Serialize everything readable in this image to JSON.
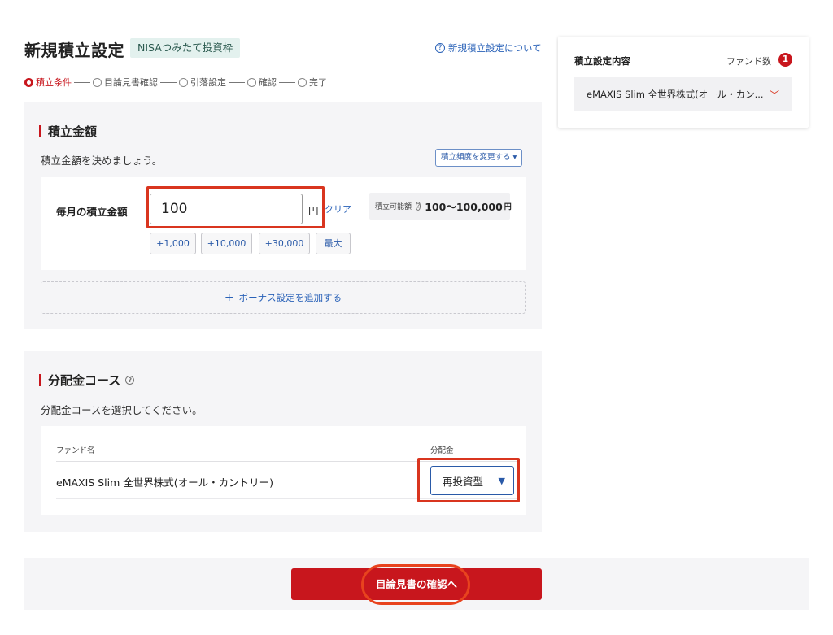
{
  "header": {
    "title": "新規積立設定",
    "badge": "NISAつみたて投資枠",
    "help_link": "新規積立設定について",
    "help_icon": "?"
  },
  "steps": [
    {
      "label": "積立条件",
      "active": true
    },
    {
      "label": "目論見書確認",
      "active": false
    },
    {
      "label": "引落設定",
      "active": false
    },
    {
      "label": "確認",
      "active": false
    },
    {
      "label": "完了",
      "active": false
    }
  ],
  "amount_section": {
    "title": "積立金額",
    "description": "積立金額を決めましょう。",
    "frequency_button": "積立頻度を変更する",
    "frequency_icon": "▾",
    "field_label": "毎月の積立金額",
    "input_value": "100",
    "unit": "円",
    "clear": "クリア",
    "range_label": "積立可能額",
    "range_help": "?",
    "range_value": "100〜100,000",
    "range_unit": "円",
    "quick_buttons": [
      "+1,000",
      "+10,000",
      "+30,000",
      "最大"
    ],
    "bonus_plus": "+",
    "bonus_label": "ボーナス設定を追加する"
  },
  "distribution_section": {
    "title": "分配金コース",
    "help_icon": "?",
    "description": "分配金コースを選択してください。",
    "col_fund": "ファンド名",
    "col_distribution": "分配金",
    "fund_name": "eMAXIS Slim 全世界株式(オール・カントリー)",
    "selected_course": "再投資型",
    "select_arrow": "▼"
  },
  "footer": {
    "confirm_button": "目論見書の確認へ"
  },
  "sidebar": {
    "title": "積立設定内容",
    "fund_count_label": "ファンド数",
    "fund_count": "1",
    "fund": "eMAXIS Slim 全世界株式(オール・カン...",
    "chevron": "﹀"
  },
  "colors": {
    "accent_red": "#c8161d",
    "link_blue": "#2a62b8",
    "badge_green": "#e3f1ee",
    "highlight_box": "#d9351f"
  },
  "icons": {
    "help": "help-circle-icon",
    "frequency": "caret-down-icon",
    "select": "triangle-down-icon",
    "side": "chevron-down-icon",
    "bonus": "plus-icon"
  }
}
